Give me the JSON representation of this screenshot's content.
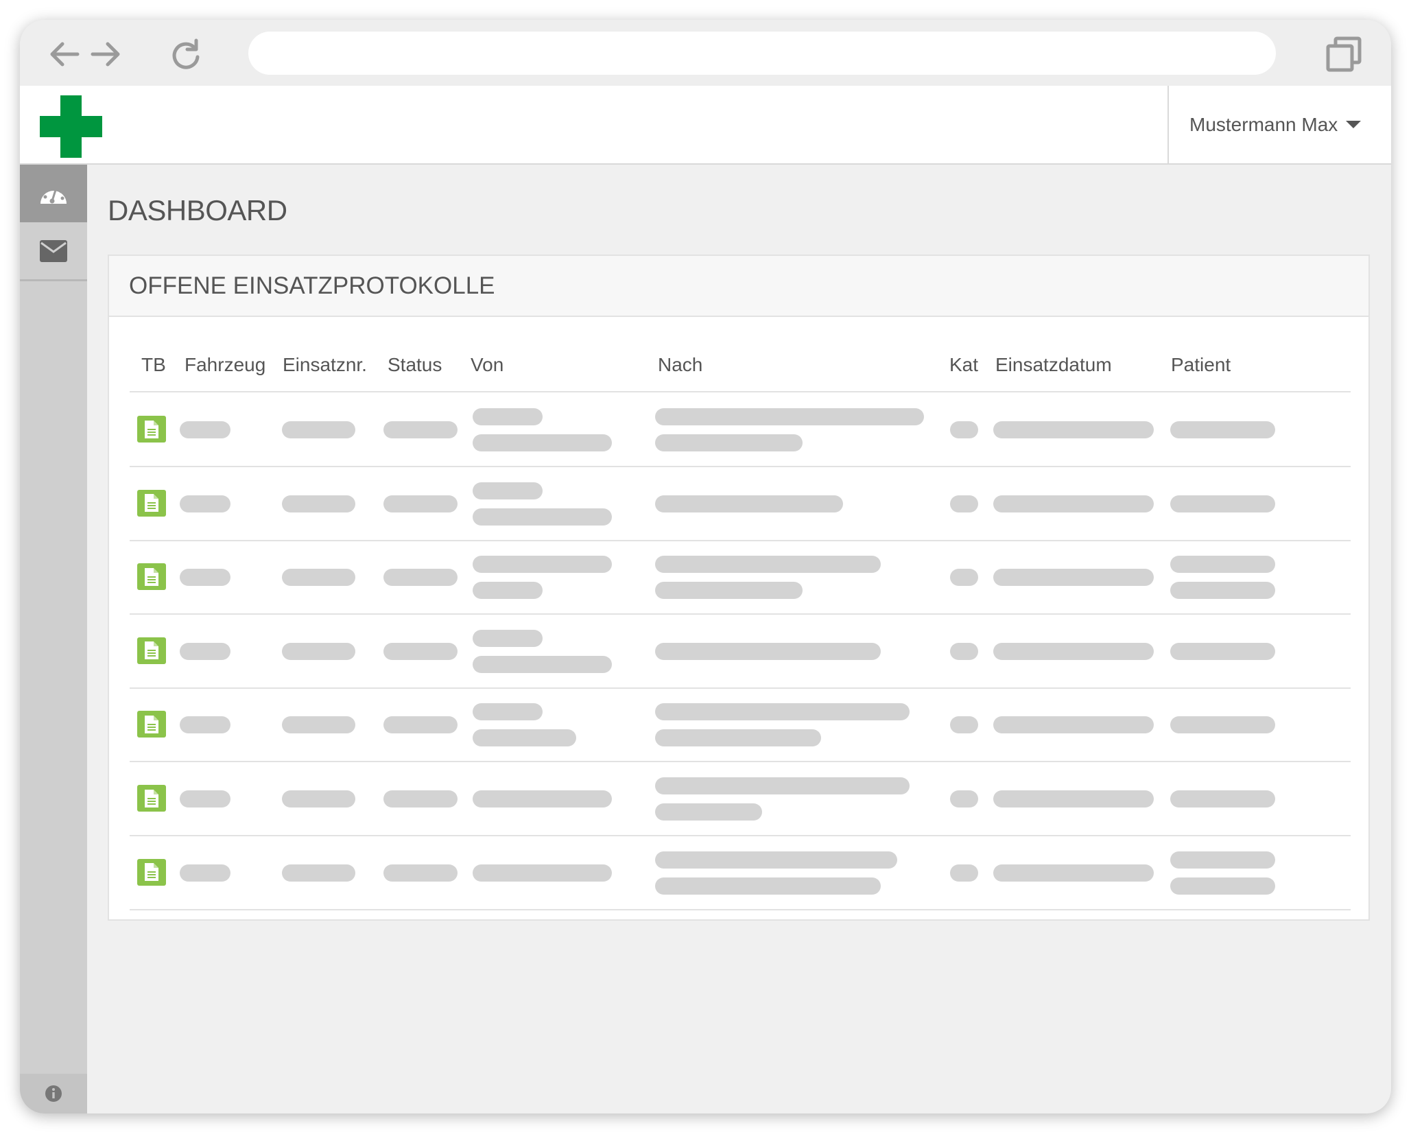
{
  "browser": {
    "url": ""
  },
  "header": {
    "user_name": "Mustermann Max"
  },
  "sidebar": {
    "items": [
      {
        "label": "dashboard",
        "active": true
      },
      {
        "label": "messages",
        "active": false
      }
    ]
  },
  "page": {
    "title": "DASHBOARD"
  },
  "panel": {
    "title": "OFFENE EINSATZPROTOKOLLE",
    "columns": [
      "TB",
      "Fahrzeug",
      "Einsatznr.",
      "Status",
      "Von",
      "Nach",
      "Kat",
      "Einsatzdatum",
      "Patient"
    ],
    "row_count": 7
  },
  "colors": {
    "brand": "#00963f",
    "doc_icon": "#8bc34a",
    "placeholder": "#d3d3d3"
  }
}
